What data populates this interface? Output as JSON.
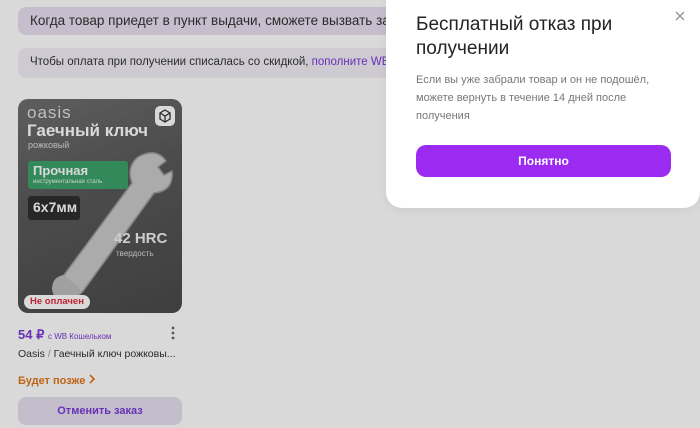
{
  "banners": {
    "pickup_text": "Когда товар приедет в пункт выдачи, сможете вызвать за ним ку",
    "discount_text": "Чтобы оплата при получении списалась со скидкой, ",
    "discount_link": "пополните WB Кошел"
  },
  "product": {
    "image": {
      "brand": "oasis",
      "title": "Гаечный ключ",
      "subtitle": "рожковый",
      "quality_title": "Прочная",
      "quality_sub": "инструментальная сталь",
      "size": "6x7мм",
      "hardness": "42 HRC",
      "hardness_label": "твердость"
    },
    "unpaid_badge": "Не оплачен",
    "price": "54 ₽",
    "price_note": "с WB Кошельком",
    "brand_name": "Oasis",
    "name": "Гаечный ключ рожковы...",
    "later_label": "Будет позже",
    "cancel_label": "Отменить заказ"
  },
  "modal": {
    "title": "Бесплатный отказ при получении",
    "text": "Если вы уже забрали товар и он не подошёл, можете вернуть в течение 14 дней после получения",
    "button_label": "Понятно"
  },
  "icons": {
    "close": "close-icon",
    "more": "more-vertical-icon",
    "chevron": "chevron-right-icon",
    "cube": "3d-view-icon"
  },
  "colors": {
    "accent": "#9b2bf0",
    "link": "#7b3ad6",
    "warning": "#e0761a",
    "danger": "#e22a3e"
  }
}
